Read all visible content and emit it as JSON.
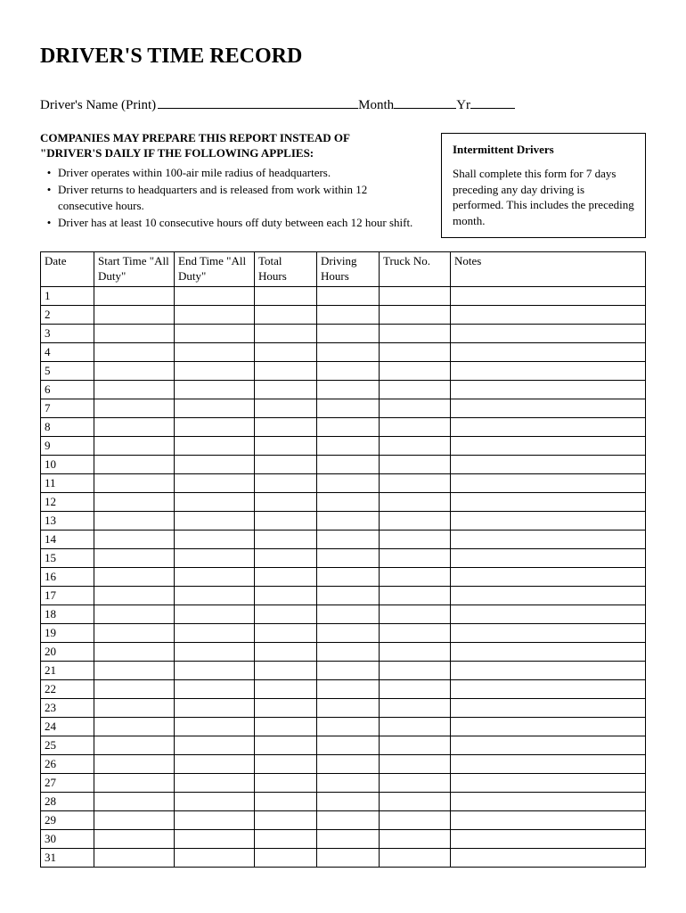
{
  "title": "DRIVER'S TIME RECORD",
  "nameLine": {
    "nameLabel": "Driver's Name (Print)",
    "monthLabel": "Month",
    "yearLabel": "Yr"
  },
  "conditions": {
    "heading1": "COMPANIES MAY PREPARE THIS REPORT INSTEAD OF",
    "heading2": " \"DRIVER'S DAILY IF THE FOLLOWING APPLIES:",
    "bullets": [
      "Driver operates within 100-air mile radius of headquarters.",
      "Driver returns to headquarters and is released from work within 12 consecutive hours.",
      "Driver has at least 10 consecutive hours off duty between each 12 hour shift."
    ]
  },
  "intermittent": {
    "title": "Intermittent Drivers",
    "body": "Shall complete this form for 7 days preceding any day driving is performed.  This includes the preceding month."
  },
  "table": {
    "headers": [
      "Date",
      "Start Time \"All Duty\"",
      "End Time \"All Duty\"",
      "Total Hours",
      "Driving Hours",
      "Truck No.",
      "Notes"
    ],
    "rows": [
      "1",
      "2",
      "3",
      "4",
      "5",
      "6",
      "7",
      "8",
      "9",
      "10",
      "11",
      "12",
      "13",
      "14",
      "15",
      "16",
      "17",
      "18",
      "19",
      "20",
      "21",
      "22",
      "23",
      "24",
      "25",
      "26",
      "27",
      "28",
      "29",
      "30",
      "31"
    ]
  }
}
